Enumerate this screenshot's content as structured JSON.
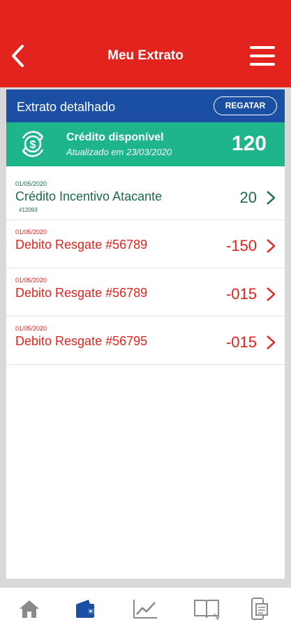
{
  "header": {
    "title": "Meu Extrato",
    "back_icon": "chevron-left-icon",
    "menu_icon": "hamburger-menu-icon",
    "color": "#e3231d"
  },
  "card": {
    "title": "Extrato detalhado",
    "button_label": "REGATAR",
    "header_color": "#1a4fa3"
  },
  "credit": {
    "label": "Crédito disponível",
    "updated": "Atualizado em 23/03/2020",
    "value": "120",
    "icon": "dollar-refresh-icon",
    "color": "#1eb58a"
  },
  "transactions": [
    {
      "date": "01/05/2020",
      "title": "Crédito Incentivo Atacante",
      "sub": "#12093",
      "value": "20",
      "type": "credit"
    },
    {
      "date": "01/05/2020",
      "title": "Debito Resgate #56789",
      "value": "-150",
      "type": "debit"
    },
    {
      "date": "01/05/2020",
      "title": "Debito Resgate #56789",
      "value": "-015",
      "type": "debit"
    },
    {
      "date": "01/05/2020",
      "title": "Debito Resgate #56795",
      "value": "-015",
      "type": "debit"
    }
  ],
  "bottom_nav": [
    {
      "icon": "home-icon",
      "active": false
    },
    {
      "icon": "wallet-icon",
      "active": true
    },
    {
      "icon": "chart-line-icon",
      "active": false
    },
    {
      "icon": "book-icon",
      "active": false
    },
    {
      "icon": "phone-receipt-icon",
      "active": false
    }
  ]
}
